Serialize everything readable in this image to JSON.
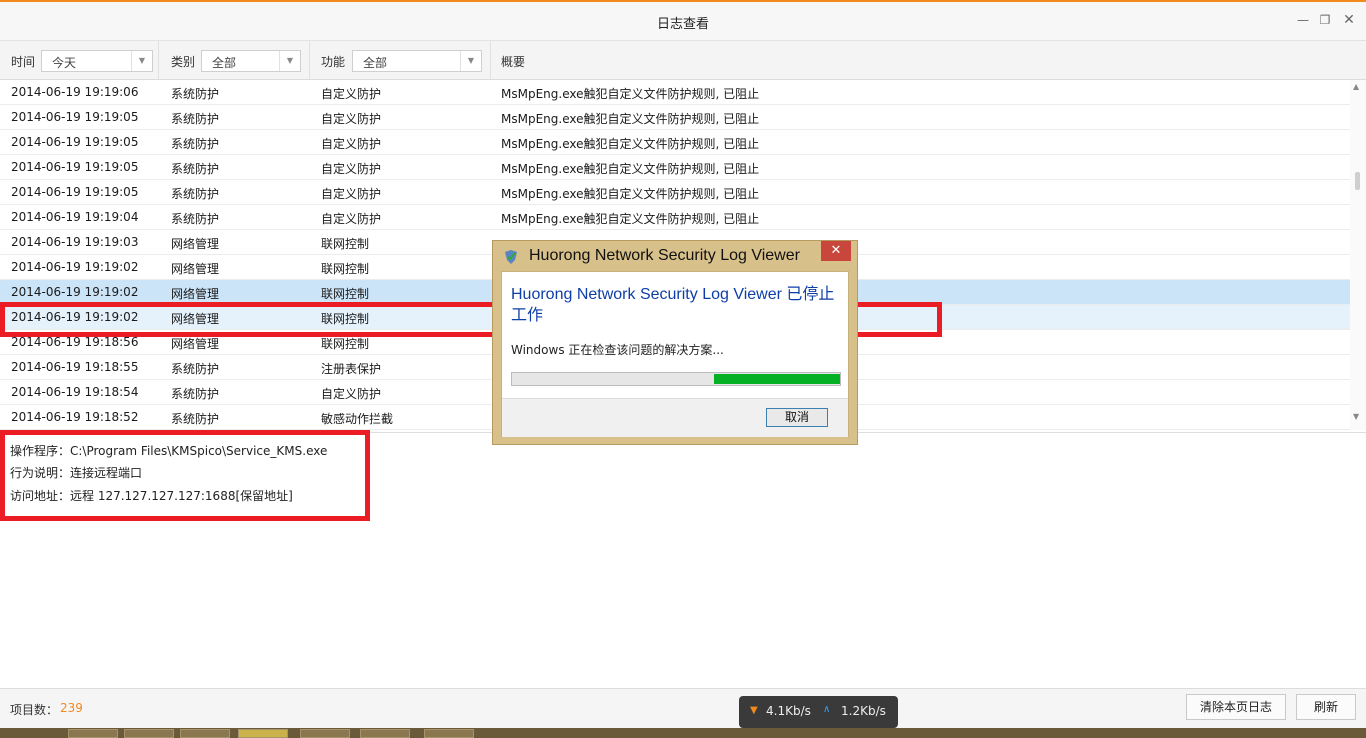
{
  "window": {
    "title": "日志查看",
    "min_icon": "minimize-icon",
    "max_icon": "restore-icon",
    "close_icon": "close-icon"
  },
  "filters": {
    "time_label": "时间",
    "time_value": "今天",
    "category_label": "类别",
    "category_value": "全部",
    "function_label": "功能",
    "function_value": "全部",
    "summary_label": "概要"
  },
  "rows": [
    {
      "time": "2014-06-19 19:19:06",
      "category": "系统防护",
      "function": "自定义防护",
      "summary": "MsMpEng.exe触犯自定义文件防护规则, 已阻止"
    },
    {
      "time": "2014-06-19 19:19:05",
      "category": "系统防护",
      "function": "自定义防护",
      "summary": "MsMpEng.exe触犯自定义文件防护规则, 已阻止"
    },
    {
      "time": "2014-06-19 19:19:05",
      "category": "系统防护",
      "function": "自定义防护",
      "summary": "MsMpEng.exe触犯自定义文件防护规则, 已阻止"
    },
    {
      "time": "2014-06-19 19:19:05",
      "category": "系统防护",
      "function": "自定义防护",
      "summary": "MsMpEng.exe触犯自定义文件防护规则, 已阻止"
    },
    {
      "time": "2014-06-19 19:19:05",
      "category": "系统防护",
      "function": "自定义防护",
      "summary": "MsMpEng.exe触犯自定义文件防护规则, 已阻止"
    },
    {
      "time": "2014-06-19 19:19:04",
      "category": "系统防护",
      "function": "自定义防护",
      "summary": "MsMpEng.exe触犯自定义文件防护规则, 已阻止"
    },
    {
      "time": "2014-06-19 19:19:03",
      "category": "网络管理",
      "function": "联网控制",
      "summary": ""
    },
    {
      "time": "2014-06-19 19:19:02",
      "category": "网络管理",
      "function": "联网控制",
      "summary": ""
    },
    {
      "time": "2014-06-19 19:19:02",
      "category": "网络管理",
      "function": "联网控制",
      "summary": ""
    },
    {
      "time": "2014-06-19 19:19:02",
      "category": "网络管理",
      "function": "联网控制",
      "summary": ""
    },
    {
      "time": "2014-06-19 19:18:56",
      "category": "网络管理",
      "function": "联网控制",
      "summary": ""
    },
    {
      "time": "2014-06-19 19:18:55",
      "category": "系统防护",
      "function": "注册表保护",
      "summary": ""
    },
    {
      "time": "2014-06-19 19:18:54",
      "category": "系统防护",
      "function": "自定义防护",
      "summary": ""
    },
    {
      "time": "2014-06-19 19:18:52",
      "category": "系统防护",
      "function": "敏感动作拦截",
      "summary": ""
    }
  ],
  "detail": {
    "program": "操作程序：C:\\Program Files\\KMSpico\\Service_KMS.exe",
    "behavior": "行为说明：连接远程端口",
    "address": "访问地址：远程 127.127.127.127:1688[保留地址]"
  },
  "dialog": {
    "title": "Huorong Network Security Log Viewer",
    "heading": "Huorong Network Security Log Viewer 已停止工作",
    "message": "Windows 正在检查该问题的解决方案...",
    "cancel_label": "取消",
    "close_glyph": "✕",
    "progress_fraction_start": 0.615,
    "progress_fraction_end": 1.0
  },
  "status": {
    "count_label": "项目数：",
    "count_value": "239",
    "clear_label": "清除本页日志",
    "refresh_label": "刷新"
  },
  "network": {
    "down_speed": "4.1Kb/s",
    "up_speed": "1.2Kb/s"
  },
  "colors": {
    "accent": "#f28a1d",
    "selected_row": "#cce4f7",
    "highlight_box": "#ec1c24",
    "dialog_heading": "#0e3ea7",
    "progress": "#06b025"
  }
}
